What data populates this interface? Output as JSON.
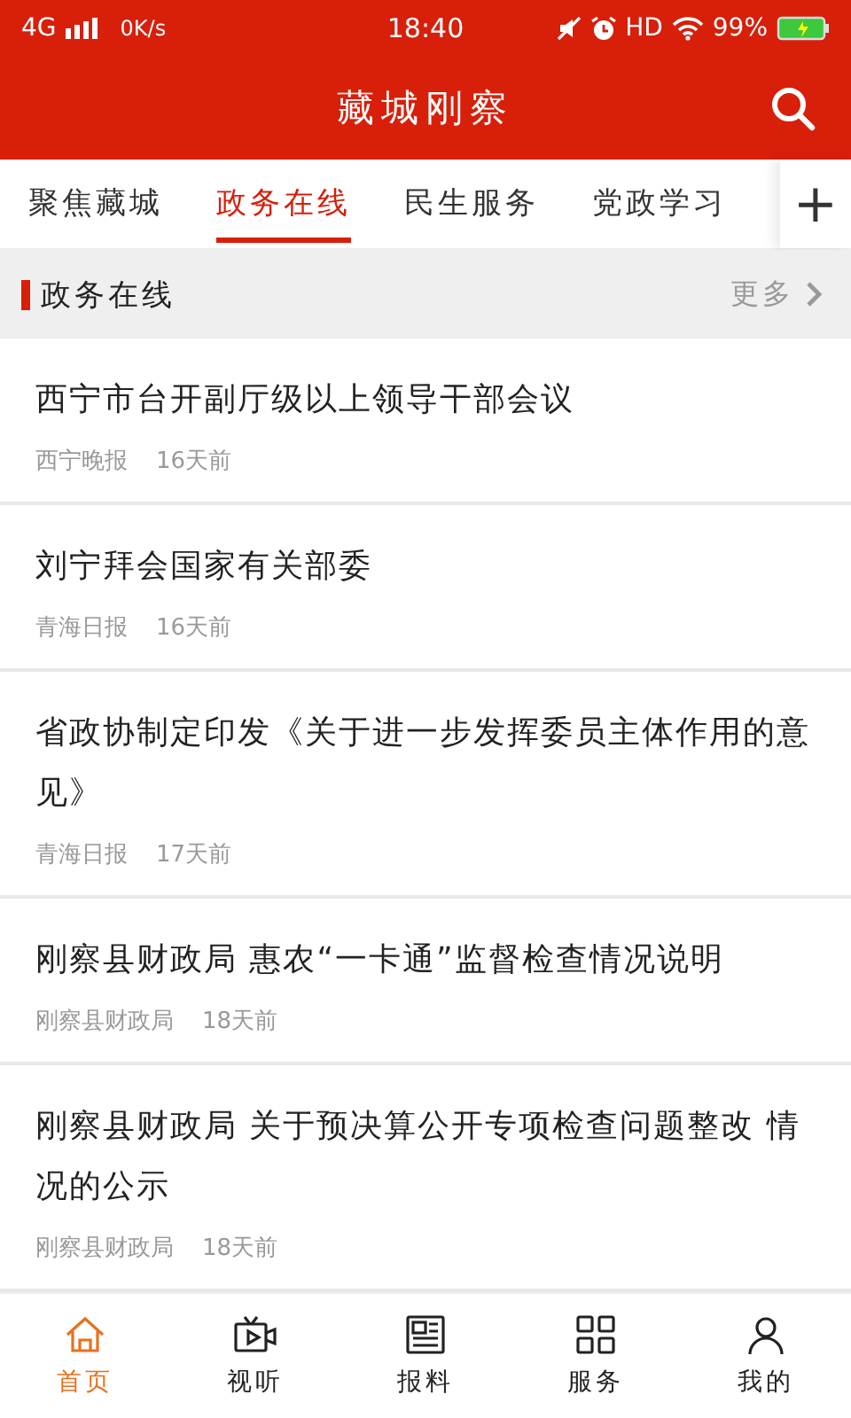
{
  "status_bar": {
    "network": "4G",
    "speed": "0K/s",
    "time": "18:40",
    "hd": "HD",
    "battery": "99%"
  },
  "header": {
    "title": "藏城刚察"
  },
  "tabs": [
    {
      "label": "聚焦藏城",
      "selected": false
    },
    {
      "label": "政务在线",
      "selected": true
    },
    {
      "label": "民生服务",
      "selected": false
    },
    {
      "label": "党政学习",
      "selected": false
    }
  ],
  "add_tab": "+",
  "section": {
    "title": "政务在线",
    "more": "更多"
  },
  "articles": [
    {
      "title": "西宁市台开副厅级以上领导干部会议",
      "source": "西宁晚报",
      "time": "16天前"
    },
    {
      "title": "刘宁拜会国家有关部委",
      "source": "青海日报",
      "time": "16天前"
    },
    {
      "title": "省政协制定印发《关于进一步发挥委员主体作用的意见》",
      "source": "青海日报",
      "time": "17天前"
    },
    {
      "title": "刚察县财政局 惠农“一卡通”监督检查情况说明",
      "source": "刚察县财政局",
      "time": "18天前"
    },
    {
      "title": "刚察县财政局 关于预决算公开专项检查问题整改 情况的公示",
      "source": "刚察县财政局",
      "time": "18天前"
    }
  ],
  "bottom_nav": [
    {
      "label": "首页",
      "kind": "home",
      "selected": true
    },
    {
      "label": "视听",
      "kind": "video",
      "selected": false
    },
    {
      "label": "报料",
      "kind": "news",
      "selected": false
    },
    {
      "label": "服务",
      "kind": "grid",
      "selected": false
    },
    {
      "label": "我的",
      "kind": "user",
      "selected": false
    }
  ]
}
